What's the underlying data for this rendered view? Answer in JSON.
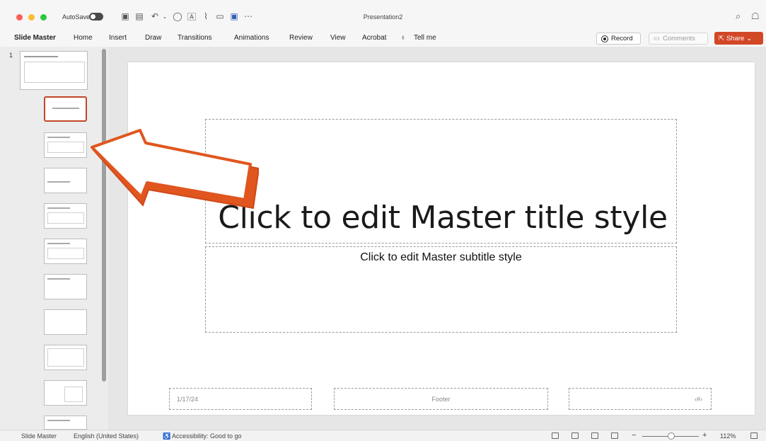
{
  "window": {
    "title": "Presentation2",
    "autosave_label": "AutoSave"
  },
  "tabs": [
    {
      "label": "Slide Master"
    },
    {
      "label": "Home"
    },
    {
      "label": "Insert"
    },
    {
      "label": "Draw"
    },
    {
      "label": "Transitions"
    },
    {
      "label": "Animations"
    },
    {
      "label": "Review"
    },
    {
      "label": "View"
    },
    {
      "label": "Acrobat"
    },
    {
      "label": "Tell me"
    }
  ],
  "actions": {
    "record_label": "Record",
    "comments_label": "Comments",
    "share_label": "Share"
  },
  "thumbnails": {
    "master_number": "1"
  },
  "slide": {
    "title": "Click to edit Master title style",
    "subtitle": "Click to edit Master subtitle style",
    "date": "1/17/24",
    "footer": "Footer",
    "number": "‹#›"
  },
  "status": {
    "view": "Slide Master",
    "language": "English (United States)",
    "accessibility": "Accessibility: Good to go",
    "zoom": "112%"
  },
  "colors": {
    "accent": "#d24726",
    "arrow_fill": "#ffffff",
    "arrow_stroke": "#e0561e"
  }
}
